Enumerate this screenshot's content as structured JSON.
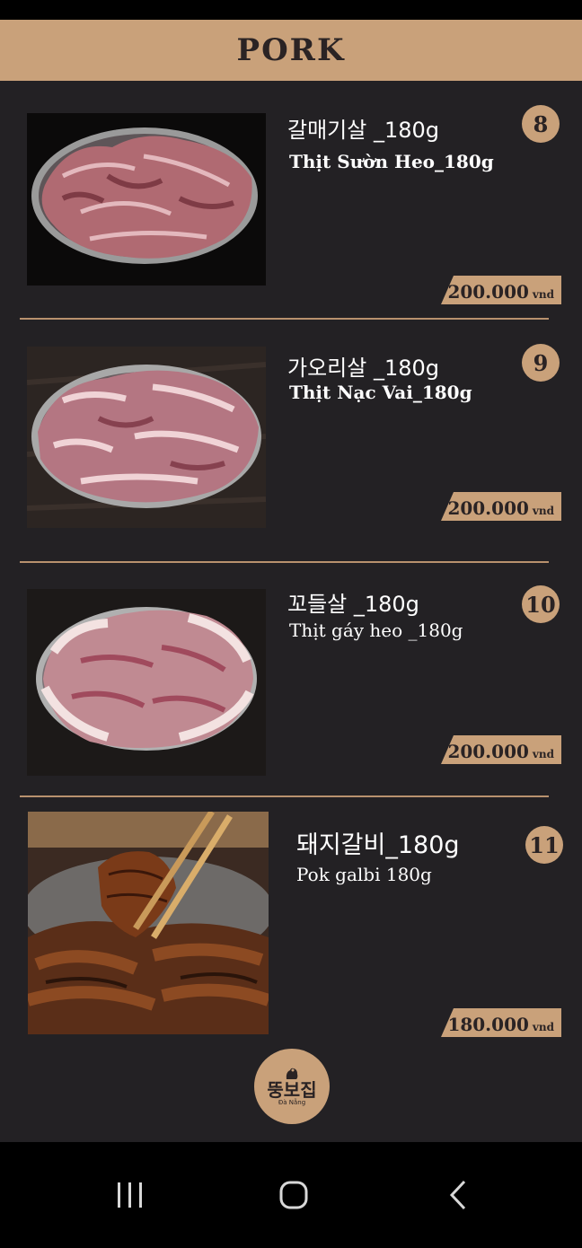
{
  "header": {
    "title": "PORK"
  },
  "items": [
    {
      "number": "8",
      "name_ko": "갈매기살 _180g",
      "name_vi": "Thịt Sườn Heo_180g",
      "price": "200.000",
      "currency": "vnd"
    },
    {
      "number": "9",
      "name_ko": "가오리살 _180g",
      "name_vi": "Thịt Nạc Vai_180g",
      "price": "200.000",
      "currency": "vnd"
    },
    {
      "number": "10",
      "name_ko": "꼬들살 _180g",
      "name_vi": "Thịt gáy heo _180g",
      "price": "200.000",
      "currency": "vnd"
    },
    {
      "number": "11",
      "name_ko": "돼지갈비_180g",
      "name_vi": "Pok galbi 180g",
      "price": "180.000",
      "currency": "vnd"
    }
  ],
  "logo": {
    "text": "뚱보집",
    "subtext": "Đà Nẵng"
  },
  "nav": {
    "recent_icon": "recent-apps-icon",
    "home_icon": "home-icon",
    "back_icon": "back-icon"
  },
  "colors": {
    "accent": "#c9a17a",
    "background": "#232124",
    "dark_text": "#2a2324"
  }
}
